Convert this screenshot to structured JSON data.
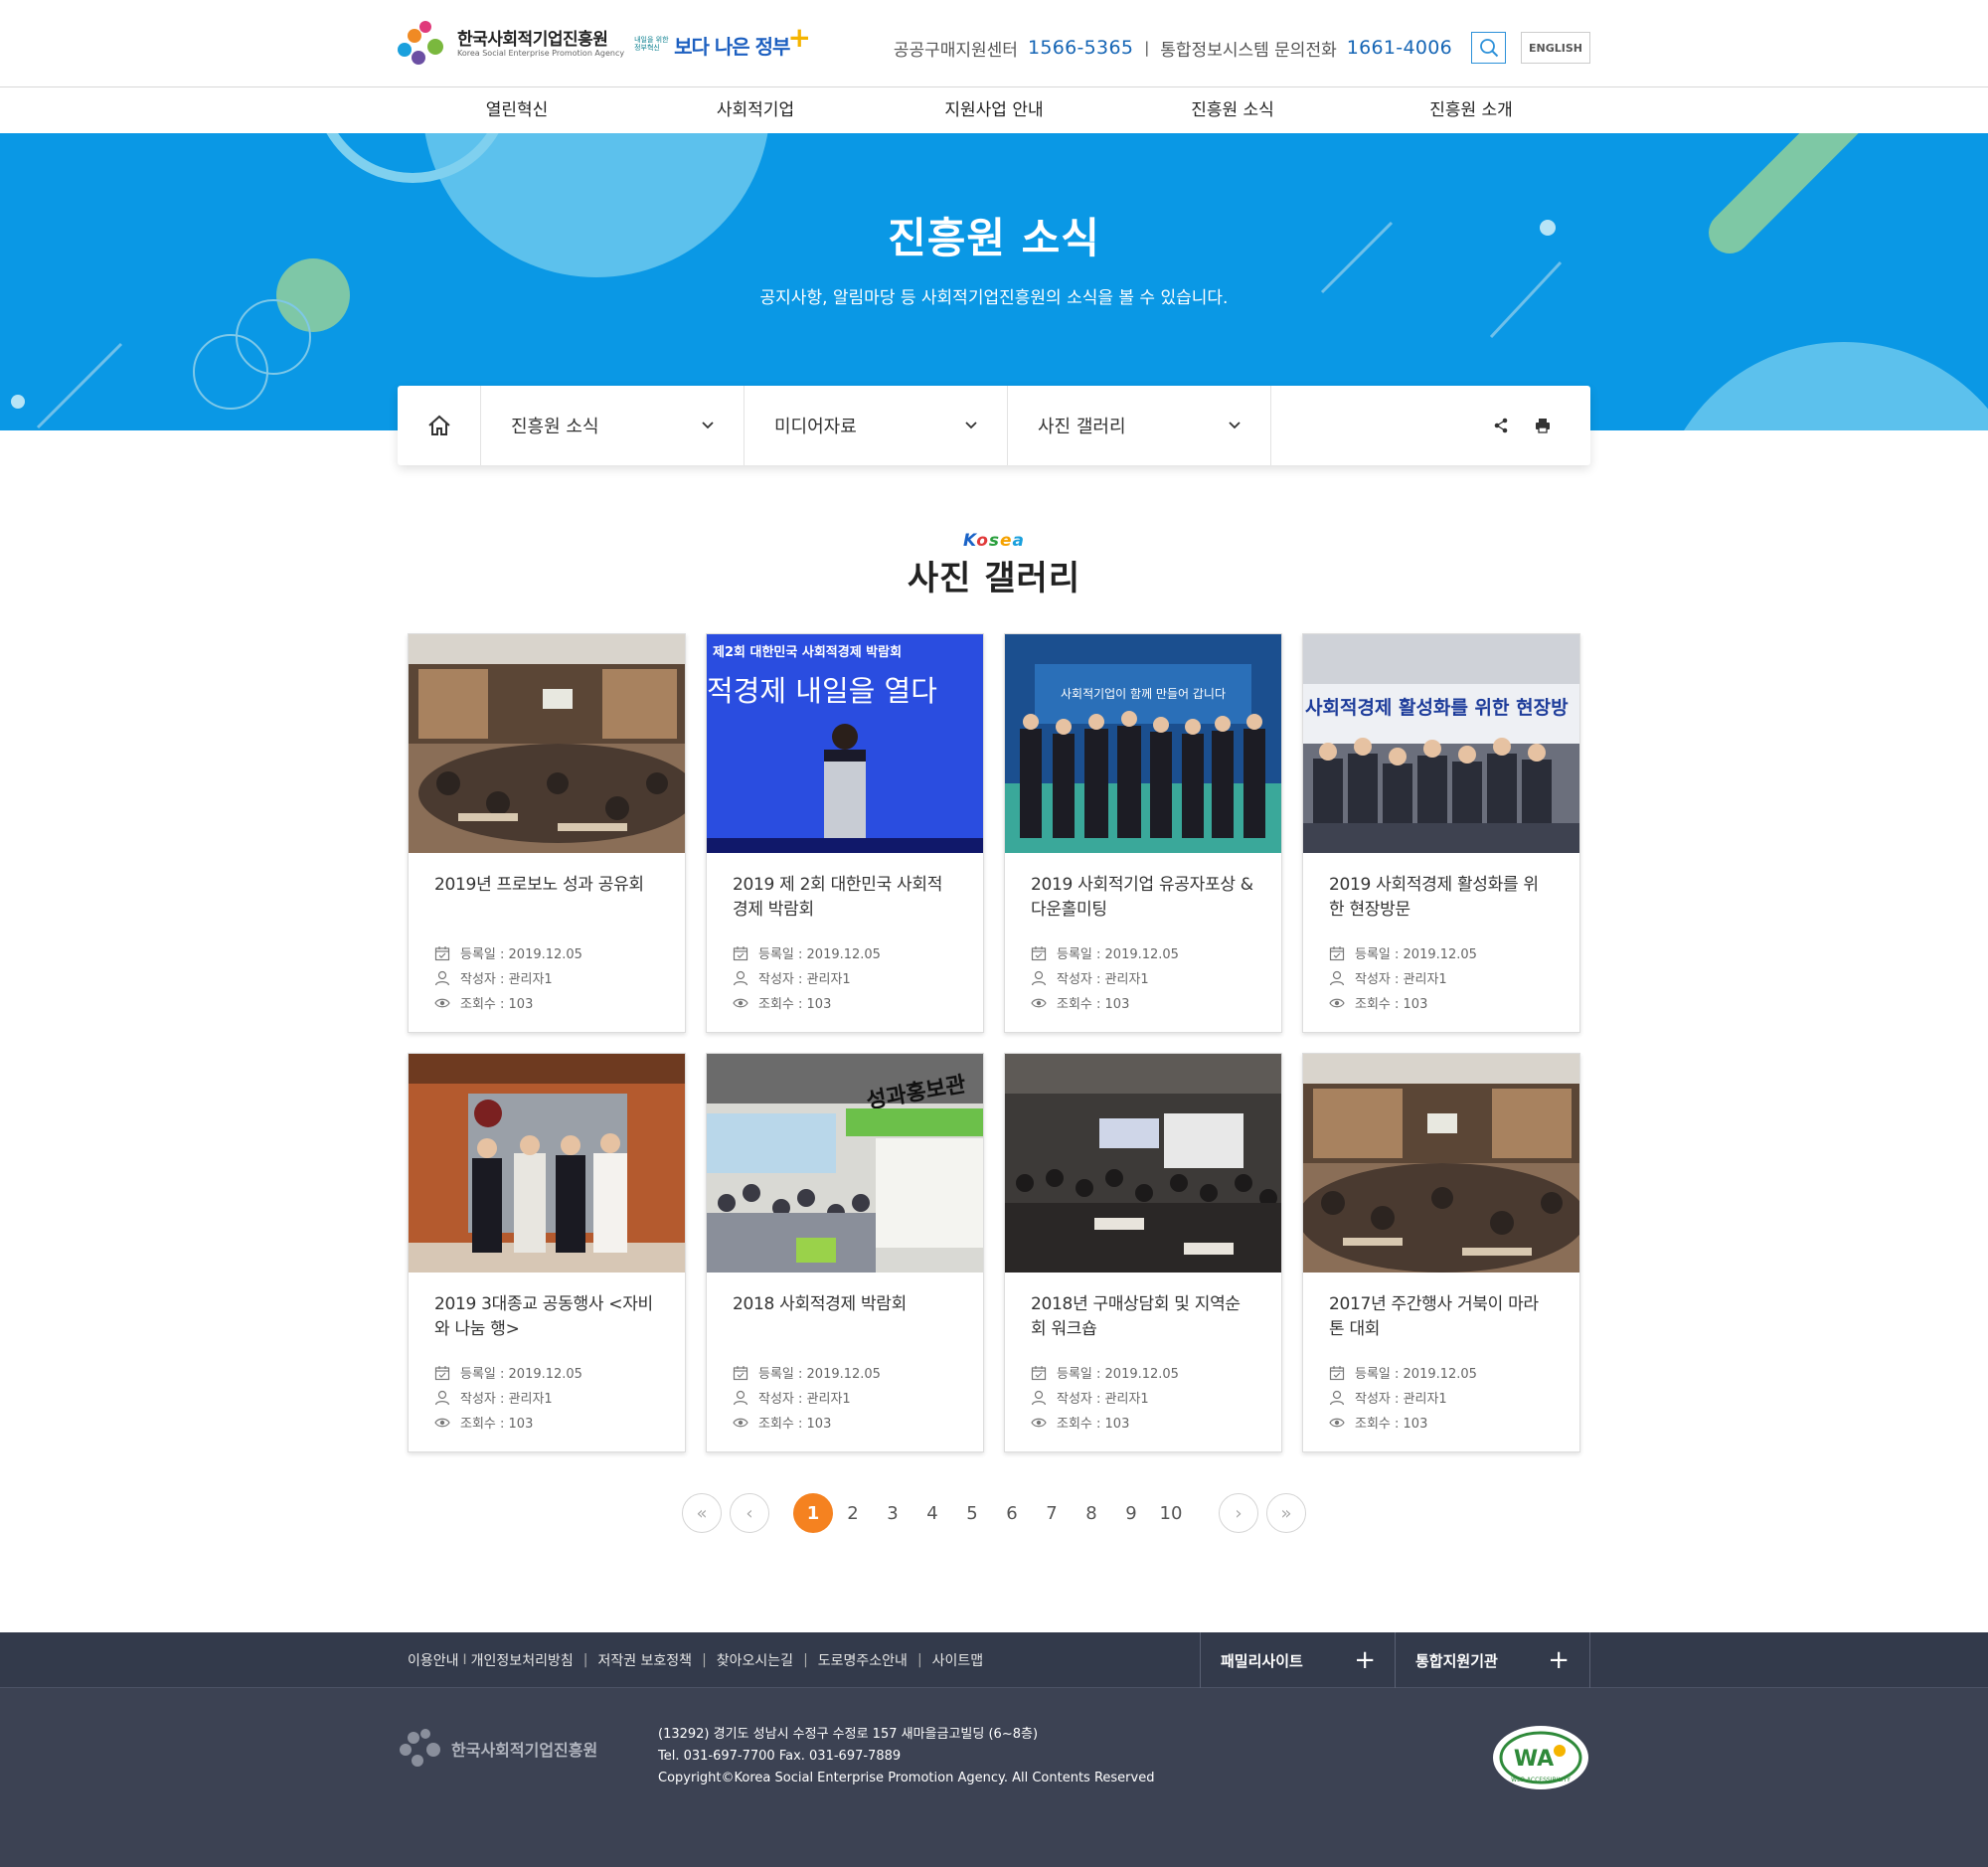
{
  "header": {
    "org_name_kr": "한국사회적기업진흥원",
    "org_name_en": "Korea Social Enterprise Promotion Agency",
    "gov_slogan_small": "내일을 위한 정부혁신",
    "gov_slogan_big": "보다 나은 정부",
    "contact1_label": "공공구매지원센터",
    "contact1_number": "1566-5365",
    "contact_separator": "|",
    "contact2_label": "통합정보시스템 문의전화",
    "contact2_number": "1661-4006",
    "english_label": "ENGLISH"
  },
  "gnb": {
    "items": [
      "열린혁신",
      "사회적기업",
      "지원사업 안내",
      "진흥원 소식",
      "진흥원 소개"
    ]
  },
  "visual": {
    "title": "진흥원 소식",
    "description": "공지사항, 알림마당 등 사회적기업진흥원의 소식을 볼 수 있습니다."
  },
  "location": {
    "depth1": "진흥원 소식",
    "depth2": "미디어자료",
    "depth3": "사진 갤러리"
  },
  "page": {
    "korea_logo": "KOREA",
    "title": "사진 갤러리"
  },
  "gallery": {
    "items": [
      {
        "title": "2019년 프로보노 성과 공유회",
        "date": "등록일 : 2019.12.05",
        "author": "작성자 : 관리자1",
        "views": "조회수 : 103",
        "thumb_text": ""
      },
      {
        "title": "2019 제 2회 대한민국 사회적경제 박람회",
        "date": "등록일 : 2019.12.05",
        "author": "작성자 : 관리자1",
        "views": "조회수 : 103",
        "thumb_text": "제2회 대한민국 사회적경제 박람회",
        "thumb_text2": "적경제 내일을 열다"
      },
      {
        "title": "2019 사회적기업 유공자포상 & 다운홀미팅",
        "date": "등록일 : 2019.12.05",
        "author": "작성자 : 관리자1",
        "views": "조회수 : 103",
        "thumb_text": "사회적기업이 함께 만들어 갑니다"
      },
      {
        "title": "2019 사회적경제 활성화를 위한 현장방문",
        "date": "등록일 : 2019.12.05",
        "author": "작성자 : 관리자1",
        "views": "조회수 : 103",
        "thumb_text": "사회적경제 활성화를 위한 현장방"
      },
      {
        "title": "2019 3대종교 공동행사 <자비와 나눔 행>",
        "date": "등록일 : 2019.12.05",
        "author": "작성자 : 관리자1",
        "views": "조회수 : 103",
        "thumb_text": ""
      },
      {
        "title": "2018 사회적경제 박람회",
        "date": "등록일 : 2019.12.05",
        "author": "작성자 : 관리자1",
        "views": "조회수 : 103",
        "thumb_text": "성과홍보관"
      },
      {
        "title": "2018년 구매상담회 및 지역순회 워크숍",
        "date": "등록일 : 2019.12.05",
        "author": "작성자 : 관리자1",
        "views": "조회수 : 103",
        "thumb_text": ""
      },
      {
        "title": "2017년 주간행사 거북이 마라톤 대회",
        "date": "등록일 : 2019.12.05",
        "author": "작성자 : 관리자1",
        "views": "조회수 : 103",
        "thumb_text": ""
      }
    ]
  },
  "pagination": {
    "first": "«",
    "prev": "‹",
    "pages": [
      "1",
      "2",
      "3",
      "4",
      "5",
      "6",
      "7",
      "8",
      "9",
      "10"
    ],
    "current": "1",
    "next": "›",
    "last": "»"
  },
  "footer": {
    "links": [
      "이용안내",
      "개인정보처리방침",
      "저작권 보호정책",
      "찾아오시는길",
      "도로명주소안내",
      "사이트맵"
    ],
    "link_separator_first": "I",
    "link_separator": "|",
    "family_site": "패밀리사이트",
    "support_org": "통합지원기관",
    "expand_symbol": "+",
    "org_name": "한국사회적기업진흥원",
    "address": "(13292) 경기도 성남시 수정구 수정로 157 새마을금고빌딩 (6~8층)",
    "tel": "Tel. 031-697-7700 Fax. 031-697-7889",
    "copyright": "Copyright©Korea Social Enterprise Promotion Agency. All Contents Reserved",
    "badge_text": "WA",
    "badge_caption": "WEB ACCESSIBILITY"
  },
  "colors": {
    "banner_blue": "#0a98e5",
    "accent_orange": "#f58220",
    "footer_dark": "#333a4b",
    "phone_blue": "#1565b5"
  }
}
